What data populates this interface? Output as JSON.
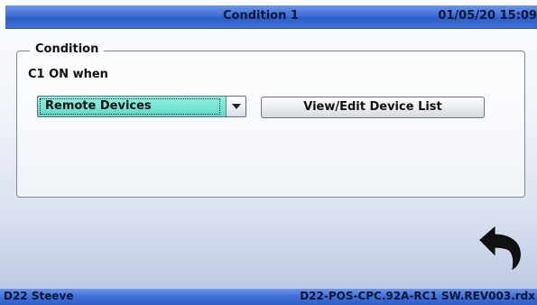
{
  "header": {
    "title": "Condition 1",
    "datetime": "01/05/20 15:09"
  },
  "condition": {
    "legend": "Condition",
    "label": "C1 ON when",
    "dropdown": {
      "selected": "Remote Devices"
    },
    "edit_button": "View/Edit Device List"
  },
  "back_icon": "back-arrow-icon",
  "status": {
    "left": "D22 Steeve",
    "right": "D22-POS-CPC.92A-RC1 SW.REV003.rdx"
  },
  "colors": {
    "titlebar": "#3f6fd6",
    "dropdown": "#5fd8c7",
    "text": "#0a1636"
  }
}
